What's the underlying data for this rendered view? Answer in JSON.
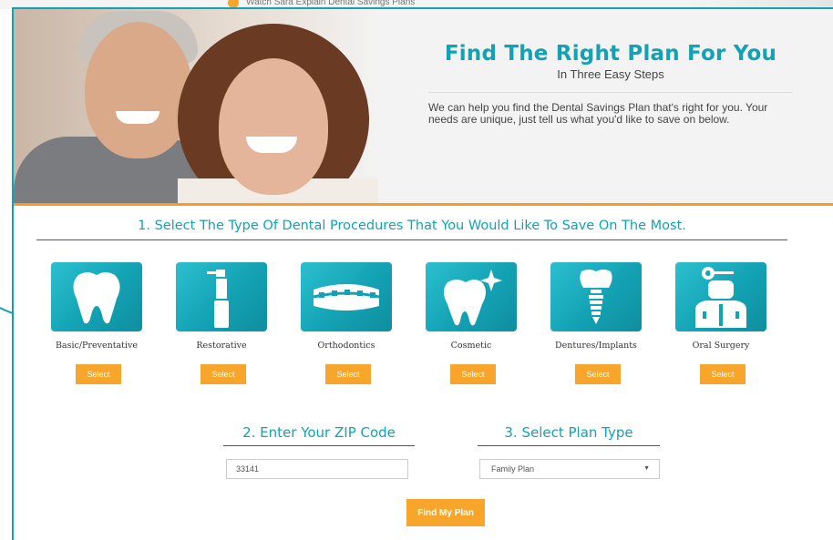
{
  "background": {
    "link_text": "Watch Sara Explain Dental Savings Plans"
  },
  "hero": {
    "title": "Find The Right Plan For You",
    "subtitle": "In Three Easy Steps",
    "description": "We can help you find the Dental Savings Plan that's right for you. Your needs are unique, just tell us what you'd like to save on below."
  },
  "step1": {
    "title": "1. Select The Type Of Dental Procedures That You Would Like To Save On The Most."
  },
  "procedures": [
    {
      "label": "Basic/Preventative",
      "button": "Select",
      "icon": "tooth-icon"
    },
    {
      "label": "Restorative",
      "button": "Select",
      "icon": "drill-icon"
    },
    {
      "label": "Orthodontics",
      "button": "Select",
      "icon": "braces-icon"
    },
    {
      "label": "Cosmetic",
      "button": "Select",
      "icon": "sparkle-tooth-icon"
    },
    {
      "label": "Dentures/Implants",
      "button": "Select",
      "icon": "implant-icon"
    },
    {
      "label": "Oral Surgery",
      "button": "Select",
      "icon": "surgeon-icon"
    }
  ],
  "step2": {
    "title": "2. Enter Your ZIP Code",
    "zip_value": "33141"
  },
  "step3": {
    "title": "3. Select Plan Type",
    "selected": "Family Plan"
  },
  "submit": {
    "label": "Find My Plan"
  },
  "colors": {
    "accent_teal": "#13a2b4",
    "accent_orange": "#f7a52b"
  }
}
